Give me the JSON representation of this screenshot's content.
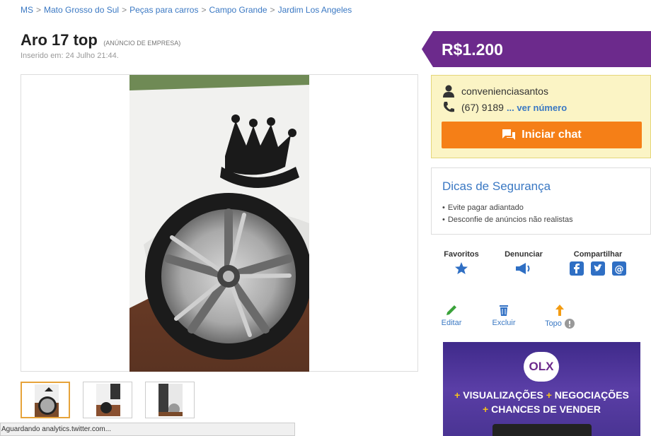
{
  "breadcrumb": [
    {
      "label": "MS"
    },
    {
      "label": "Mato Grosso do Sul"
    },
    {
      "label": "Peças para carros"
    },
    {
      "label": "Campo Grande"
    },
    {
      "label": "Jardim Los Angeles"
    }
  ],
  "listing": {
    "title": "Aro 17 top",
    "company_tag": "(ANÚNCIO DE EMPRESA)",
    "inserted": "Inserido em: 24 Julho 21:44.",
    "price": "R$1.200"
  },
  "seller": {
    "name": "convenienciasantos",
    "phone": "(67) 9189",
    "phone_more": "... ver número",
    "chat_label": "Iniciar chat"
  },
  "tips": {
    "title": "Dicas de Segurança",
    "items": [
      "Evite pagar adiantado",
      "Desconfie de anúncios não realistas"
    ]
  },
  "actions": {
    "favorites": "Favoritos",
    "report": "Denunciar",
    "share": "Compartilhar"
  },
  "edit_actions": {
    "edit": "Editar",
    "delete": "Excluir",
    "top": "Topo"
  },
  "ad": {
    "logo": "OLX",
    "line1_a": "VISUALIZAÇÕES",
    "line1_b": "NEGOCIAÇÕES",
    "line2": "CHANCES DE VENDER"
  },
  "status_bar": "Aguardando analytics.twitter.com...",
  "colors": {
    "link": "#3a78c3",
    "price_bg": "#6c2a8c",
    "chat_button": "#f57f17",
    "seller_bg": "#fbf4c5"
  }
}
